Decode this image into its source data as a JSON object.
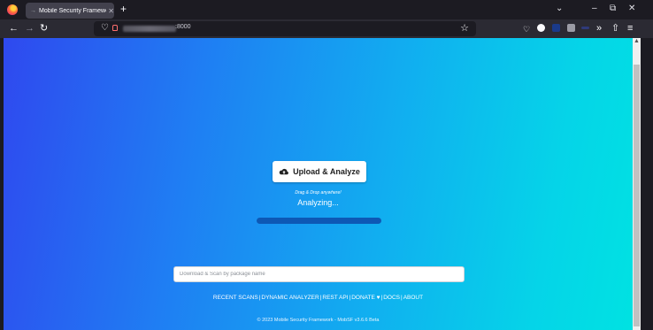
{
  "browser": {
    "tab_title": "Mobile Security Framework",
    "url_port": ":8000"
  },
  "page": {
    "upload_button": "Upload & Analyze",
    "drag_drop_hint": "Drag & Drop anywhere!",
    "status": "Analyzing...",
    "progress": 1.0,
    "search": {
      "placeholder": "Download & Scan by package name",
      "value": ""
    },
    "footer_links": [
      "RECENT SCANS",
      "DYNAMIC ANALYZER",
      "REST API",
      "DONATE ♥",
      "DOCS",
      "ABOUT"
    ],
    "copyright": "© 2023 Mobile Security Framework - MobSF v3.6.6 Beta"
  },
  "colors": {
    "gradient_start": "#2f49ef",
    "gradient_end": "#00e2e2",
    "progress_fill": "#0d58b5"
  }
}
